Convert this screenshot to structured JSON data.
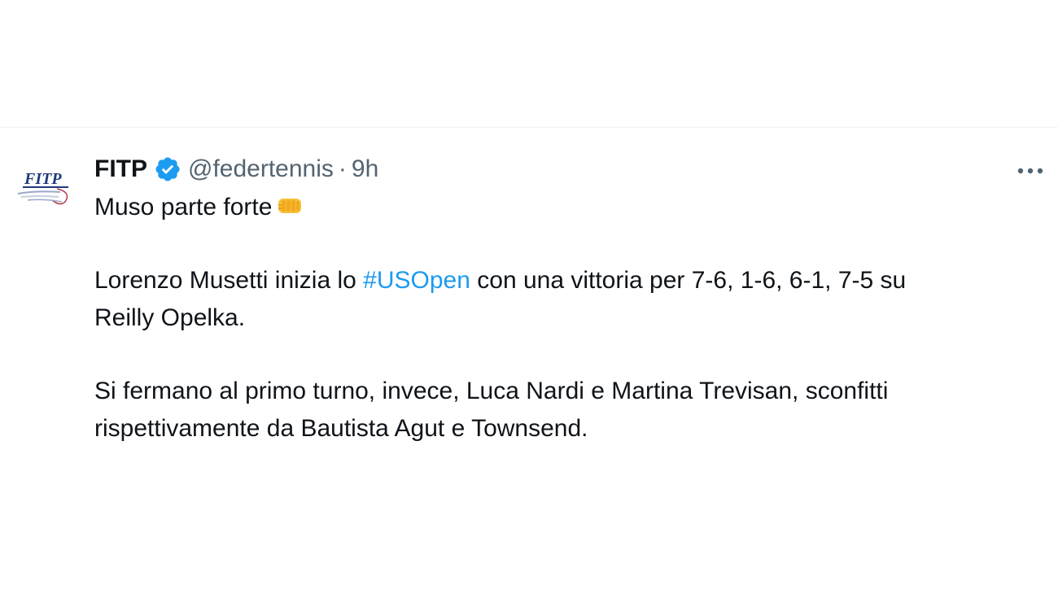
{
  "tweet": {
    "display_name": "FITP",
    "handle": "@federtennis",
    "separator": "·",
    "time": "9h",
    "verified_color": "#1d9bf0",
    "more_icon": "more-horizontal-icon",
    "avatar_text": "FITP",
    "line1": "Muso parte forte",
    "line1_emoji": "oncoming-fist-icon",
    "para2_before": "Lorenzo Musetti inizia lo ",
    "hashtag": "#USOpen",
    "para2_after_line1": " con una vittoria per 7-6, 1-6, 6-1, 7-5 su",
    "para2_line2": "Reilly Opelka.",
    "para3_line1": "Si fermano al primo turno, invece, Luca Nardi e Martina Trevisan, sconfitti",
    "para3_line2": "rispettivamente da Bautista Agut e Townsend."
  },
  "colors": {
    "text": "#0f1419",
    "muted": "#536471",
    "link": "#1d9bf0",
    "divider": "#eff3f4"
  }
}
